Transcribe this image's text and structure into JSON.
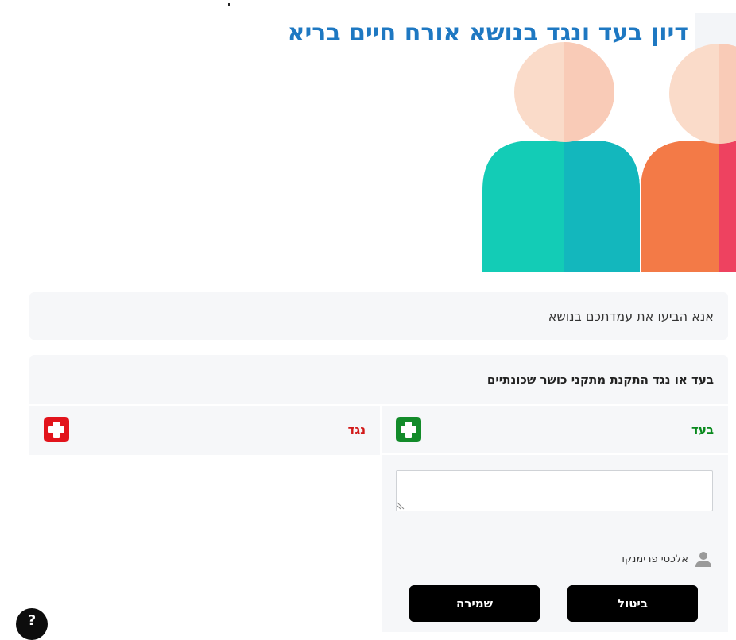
{
  "page": {
    "title": "דיון בעד ונגד בנושא אורח חיים בריא"
  },
  "prompt": {
    "text": "אנא הביעו את עמדתכם בנושא"
  },
  "topic": {
    "heading": "בעד או נגד התקנת מתקני כושר שכונתיים",
    "pro": {
      "label": "בעד",
      "add_icon": "plus-icon",
      "color": "#138b2a"
    },
    "con": {
      "label": "נגד",
      "add_icon": "plus-icon",
      "color": "#e2141c"
    },
    "editor": {
      "value": "",
      "author_name": "אלכסי פרימנקו",
      "author_icon": "user-icon",
      "cancel_label": "ביטול",
      "save_label": "שמירה"
    }
  },
  "help": {
    "label": "?"
  },
  "colors": {
    "title": "#1e78c2",
    "teal": "#14c8b4",
    "orange": "#f47a48",
    "skin": "#f9d4c3",
    "card": "#f6f7f9"
  }
}
